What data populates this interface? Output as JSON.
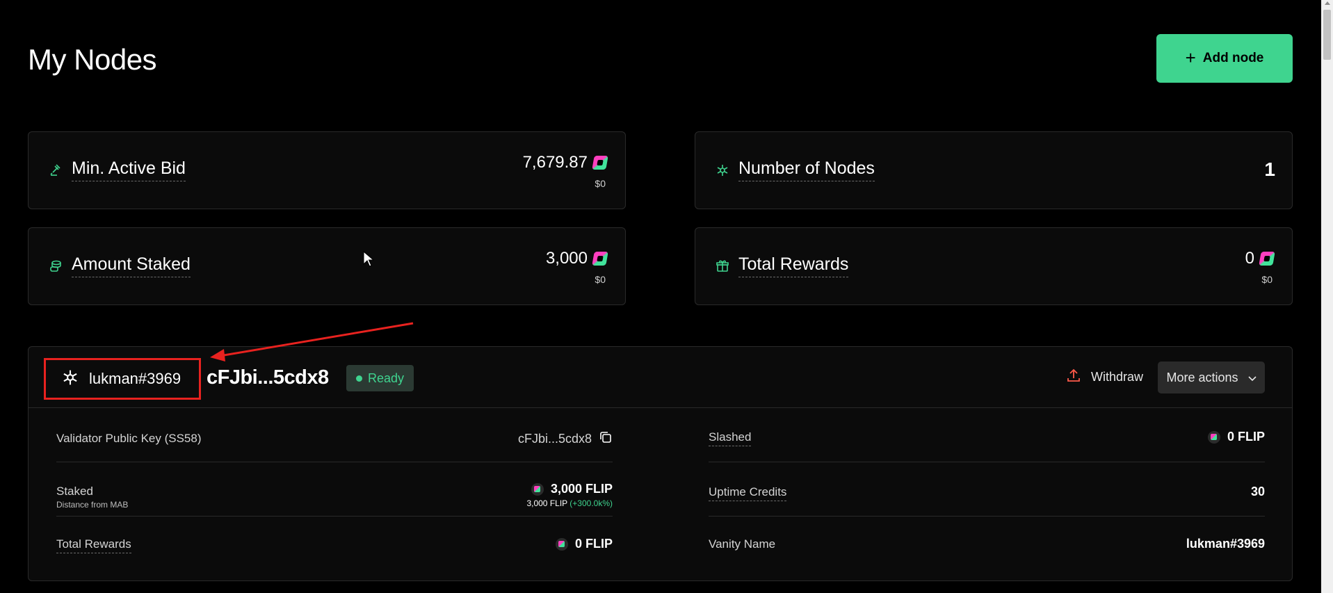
{
  "header": {
    "title": "My Nodes",
    "add_node_label": "Add node"
  },
  "stats": {
    "min_active_bid": {
      "label": "Min. Active Bid",
      "value": "7,679.87",
      "usd": "$0"
    },
    "amount_staked": {
      "label": "Amount Staked",
      "value": "3,000",
      "usd": "$0"
    },
    "number_of_nodes": {
      "label": "Number of Nodes",
      "value": "1"
    },
    "total_rewards": {
      "label": "Total Rewards",
      "value": "0",
      "usd": "$0"
    }
  },
  "node": {
    "vanity_id": "lukman#3969",
    "address_short": "cFJbi...5cdx8",
    "status": "Ready",
    "withdraw_label": "Withdraw",
    "more_actions_label": "More actions",
    "details_left": {
      "public_key": {
        "label": "Validator Public Key (SS58)",
        "value": "cFJbi...5cdx8"
      },
      "staked": {
        "label": "Staked",
        "sublabel": "Distance from MAB",
        "value": "3,000 FLIP",
        "subvalue": "3,000 FLIP",
        "subvalue_pct": "(+300.0k%)"
      },
      "total_rewards": {
        "label": "Total Rewards",
        "value": "0 FLIP"
      }
    },
    "details_right": {
      "slashed": {
        "label": "Slashed",
        "value": "0 FLIP"
      },
      "uptime_credits": {
        "label": "Uptime Credits",
        "value": "30"
      },
      "vanity_name": {
        "label": "Vanity Name",
        "value": "lukman#3969"
      }
    }
  },
  "colors": {
    "accent": "#3fd48f",
    "annotation": "#e8221f",
    "background": "#000000",
    "card": "#0b0b0b"
  },
  "icons": {
    "add": "plus-icon",
    "bid": "gavel-icon",
    "staked": "coins-icon",
    "nodes": "network-icon",
    "rewards": "gift-icon",
    "token": "flip-token-icon",
    "copy": "copy-icon",
    "withdraw": "upload-icon",
    "dropdown": "chevron-down-icon"
  }
}
